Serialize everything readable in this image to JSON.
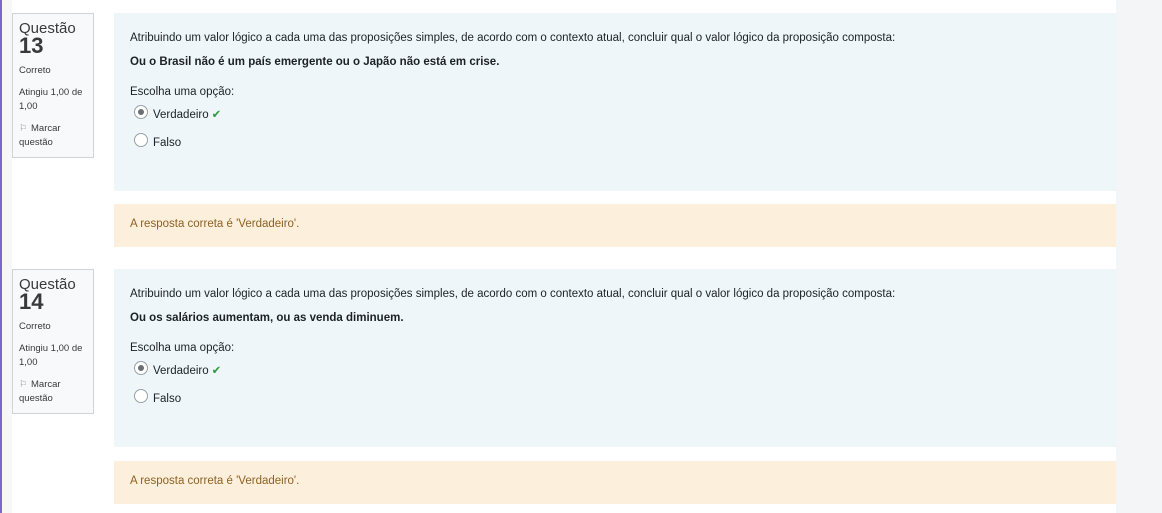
{
  "questions": [
    {
      "info": {
        "label": "Questão",
        "number": "13",
        "state": "Correto",
        "grade": "Atingiu 1,00 de 1,00",
        "flag_label": "Marcar questão"
      },
      "text": "Atribuindo um valor lógico a cada uma das proposições simples, de acordo com o contexto atual, concluir qual o valor lógico da proposição composta:",
      "proposition": "Ou o Brasil não é um país emergente ou o Japão não está em crise.",
      "prompt": "Escolha uma opção:",
      "options": [
        {
          "label": "Verdadeiro",
          "selected": true,
          "correct_icon": "✔"
        },
        {
          "label": "Falso",
          "selected": false
        }
      ],
      "feedback": "A resposta correta é 'Verdadeiro'."
    },
    {
      "info": {
        "label": "Questão",
        "number": "14",
        "state": "Correto",
        "grade": "Atingiu 1,00 de 1,00",
        "flag_label": "Marcar questão"
      },
      "text": "Atribuindo um valor lógico a cada uma das proposições simples, de acordo com o contexto atual, concluir qual o valor lógico da proposição composta:",
      "proposition": "Ou os salários aumentam, ou as venda diminuem.",
      "prompt": "Escolha uma opção:",
      "options": [
        {
          "label": "Verdadeiro",
          "selected": true,
          "correct_icon": "✔"
        },
        {
          "label": "Falso",
          "selected": false
        }
      ],
      "feedback": "A resposta correta é 'Verdadeiro'."
    }
  ],
  "colors": {
    "accent_stripe": "#7b66c9",
    "formulation_bg": "#eef6f9",
    "feedback_bg": "#fcefdc",
    "feedback_text": "#8e6224",
    "correct_check": "#2e9d3a"
  },
  "icons": {
    "flag": "flag-icon",
    "correct": "check-icon"
  }
}
